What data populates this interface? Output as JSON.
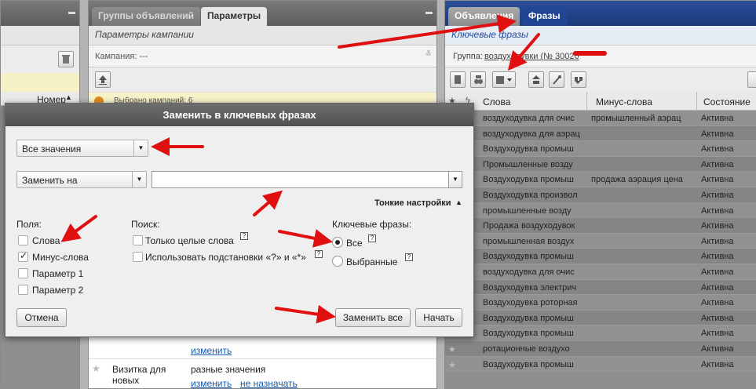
{
  "left_panel": {
    "column_header": "Номер"
  },
  "mid_panel": {
    "tabs": [
      "Группы объявлений",
      "Параметры"
    ],
    "subtitle": "Параметры кампании",
    "campaign_label": "Кампания: ---",
    "selected_text": "Выбрано кампаний: 6",
    "rows": [
      {
        "link": "изменить"
      },
      {
        "label": "Визитка для новых",
        "value": "разные значения",
        "links": [
          "изменить",
          "не назначать"
        ]
      }
    ]
  },
  "right_panel": {
    "tabs": [
      "Объявления",
      "Фразы"
    ],
    "subtitle": "Ключевые фразы",
    "group_label": "Группа:",
    "group_value": "воздуходувки (№ 30020",
    "columns": [
      "Слова",
      "Минус-слова",
      "Состояние"
    ],
    "rows": [
      {
        "words": "воздуходувка для очис",
        "minus": "промышленный аэрац",
        "status": "Активна"
      },
      {
        "words": "воздуходувка для аэрац",
        "minus": "",
        "status": "Активна"
      },
      {
        "words": "Воздуходувка промыш",
        "minus": "",
        "status": "Активна"
      },
      {
        "words": "Промышленные возду",
        "minus": "",
        "status": "Активна"
      },
      {
        "words": "Воздуходувка промыш",
        "minus": "продажа аэрация цена",
        "status": "Активна"
      },
      {
        "words": "Воздуходувка произвол",
        "minus": "",
        "status": "Активна"
      },
      {
        "words": "промышленные возду",
        "minus": "",
        "status": "Активна"
      },
      {
        "words": "Продажа воздуходувок",
        "minus": "",
        "status": "Активна"
      },
      {
        "words": "промышленная воздух",
        "minus": "",
        "status": "Активна"
      },
      {
        "words": "Воздуходувка промыш",
        "minus": "",
        "status": "Активна"
      },
      {
        "words": "воздуходувка для очис",
        "minus": "",
        "status": "Активна"
      },
      {
        "words": "Воздуходувка электрич",
        "minus": "",
        "status": "Активна"
      },
      {
        "words": "Воздуходувка роторная",
        "minus": "",
        "status": "Активна"
      },
      {
        "words": "Воздуходувка промыш",
        "minus": "",
        "status": "Активна"
      },
      {
        "words": "Воздуходувка промыш",
        "minus": "",
        "status": "Активна"
      },
      {
        "words": "ротационные воздухо",
        "minus": "",
        "status": "Активна"
      },
      {
        "words": "Воздуходувка промыш",
        "minus": "",
        "status": "Активна"
      }
    ]
  },
  "dialog": {
    "title": "Заменить в ключевых фразах",
    "scope_select": "Все значения",
    "action_select": "Заменить на",
    "replace_value": "",
    "fine_settings": "Тонкие настройки",
    "fields_label": "Поля:",
    "fields": [
      {
        "label": "Слова",
        "checked": false
      },
      {
        "label": "Минус-слова",
        "checked": true
      },
      {
        "label": "Параметр 1",
        "checked": false
      },
      {
        "label": "Параметр 2",
        "checked": false
      }
    ],
    "search_label": "Поиск:",
    "search_options": [
      {
        "label": "Только целые слова",
        "checked": false
      },
      {
        "label": "Использовать подстановки «?» и «*»",
        "checked": false
      }
    ],
    "keywords_label": "Ключевые фразы:",
    "keyword_options": [
      {
        "label": "Все",
        "selected": true
      },
      {
        "label": "Выбранные",
        "selected": false
      }
    ],
    "help_glyph": "?",
    "cancel": "Отмена",
    "replace_all": "Заменить все",
    "start": "Начать"
  },
  "colors": {
    "annotation_arrow": "#e01010",
    "link": "#1a5aa8"
  }
}
